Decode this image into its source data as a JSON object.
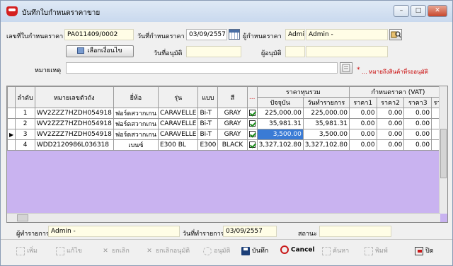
{
  "window": {
    "title": "บันทึกใบกำหนดราคาขาย",
    "minimize": "–",
    "maximize": "□",
    "close": "✕"
  },
  "header": {
    "doc_no_label": "เลขที่ใบกำหนดราคา",
    "doc_no_value": "PA011409/0002",
    "doc_date_label": "วันที่กำหนดราคา",
    "doc_date_value": "03/09/2557",
    "creator_label": "ผู้กำหนดราคา",
    "creator_code": "Admin",
    "creator_name": "Admin -",
    "select_item_button": "เลือกเงื่อนไข",
    "approve_date_label": "วันที่อนุมัติ",
    "approve_date_value": "",
    "approver_label": "ผู้อนุมัติ",
    "approver_code": "",
    "approver_name": "",
    "note_label": "หมายเหตุ",
    "note_value": "",
    "note_asterisk": "*",
    "note_hint": "... หมายถึงสินค้าที่รออนุมัติ"
  },
  "grid": {
    "columns": {
      "seq": "ลำดับ",
      "chassis": "หมายเลขตัวถัง",
      "brand": "ยี่ห้อ",
      "model": "รุ่น",
      "type": "แบบ",
      "color": "สี",
      "dots": "...",
      "cost_group": "ราคาทุนรวม",
      "cost_current": "ปัจจุบัน",
      "cost_txn": "วันทำรายการ",
      "price_group": "กำหนดราคา (VAT)",
      "price1": "ราคา1",
      "price2": "ราคา2",
      "price3": "ราคา3",
      "price4": "ราค"
    },
    "rows": [
      {
        "seq": "1",
        "chassis": "WV2ZZZ7HZDH054918",
        "brand": "ฟอร์ดสวากเกน",
        "model": "CARAVELLE",
        "type": "Bi-T",
        "color": "GRAY",
        "cost_current": "225,000.00",
        "cost_txn": "225,000.00",
        "p1": "0.00",
        "p2": "0.00",
        "p3": "0.00",
        "marker": ""
      },
      {
        "seq": "2",
        "chassis": "WV2ZZZ7HZDH054918",
        "brand": "ฟอร์ดสวากเกน",
        "model": "CARAVELLE",
        "type": "Bi-T",
        "color": "GRAY",
        "cost_current": "35,981.31",
        "cost_txn": "35,981.31",
        "p1": "0.00",
        "p2": "0.00",
        "p3": "0.00",
        "marker": ""
      },
      {
        "seq": "3",
        "chassis": "WV2ZZZ7HZDH054918",
        "brand": "ฟอร์ดสวากเกน",
        "model": "CARAVELLE",
        "type": "Bi-T",
        "color": "GRAY",
        "cost_current": "3,500.00",
        "cost_txn": "3,500.00",
        "p1": "0.00",
        "p2": "0.00",
        "p3": "0.00",
        "marker": "▶"
      },
      {
        "seq": "4",
        "chassis": "WDD2120986L036318",
        "brand": "เบนซ์",
        "model": "E300 BL",
        "type": "E300",
        "color": "BLACK",
        "cost_current": "3,327,102.80",
        "cost_txn": "3,327,102.80",
        "p1": "0.00",
        "p2": "0.00",
        "p3": "0.00",
        "marker": ""
      }
    ]
  },
  "footer": {
    "recorder_label": "ผู้ทำรายการ",
    "recorder_value": "Admin -",
    "txn_date_label": "วันที่ทำรายการ",
    "txn_date_value": "03/09/2557",
    "status_label": "สถานะ",
    "status_value": ""
  },
  "toolbar": {
    "add": "เพิ่ม",
    "edit": "แก้ไข",
    "cancel_doc": "ยกเลิก",
    "cancel_approve": "ยกเลิกอนุมัติ",
    "approve": "อนุมัติ",
    "save": "บันทึก",
    "cancel": "Cancel",
    "search": "ค้นหา",
    "print": "พิมพ์",
    "close": "ปิด"
  },
  "colors": {
    "field_bg": "#fffde6",
    "grid_empty": "#c9b3f0",
    "selected_cell": "#3a7bd5"
  }
}
